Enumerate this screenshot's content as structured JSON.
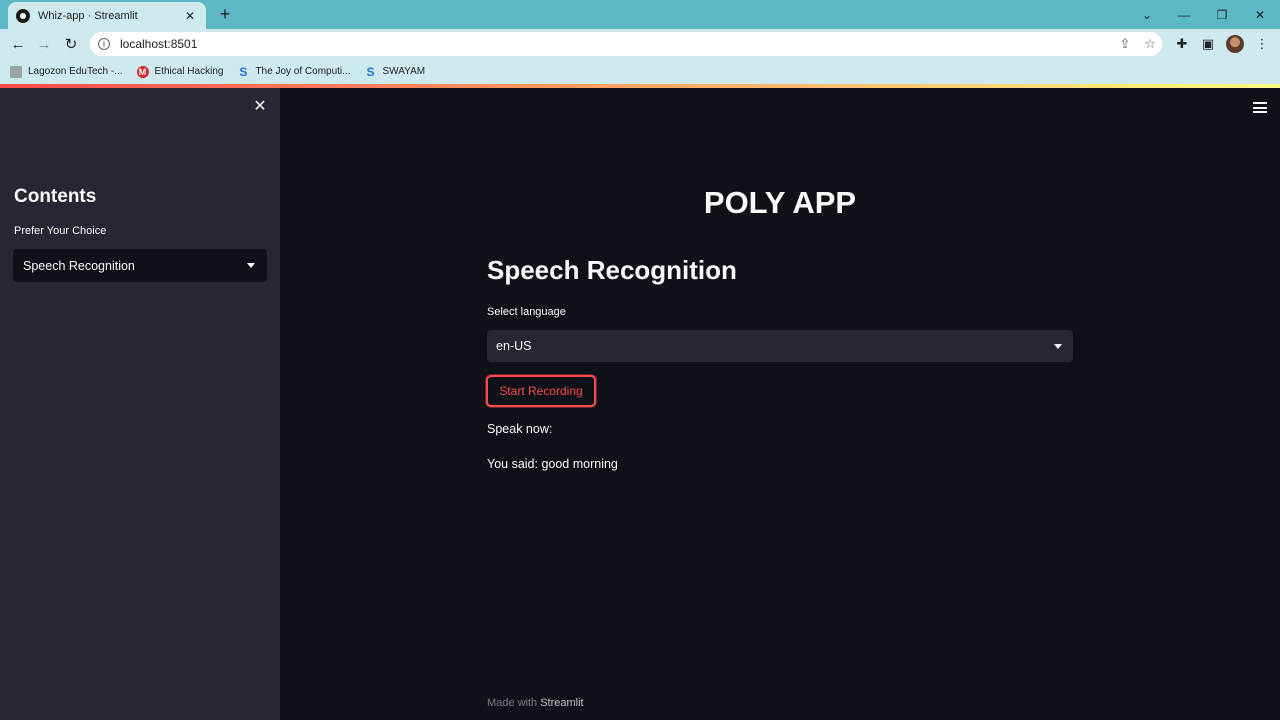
{
  "browser": {
    "tab_title": "Whiz-app · Streamlit",
    "url": "localhost:8501",
    "bookmarks": [
      {
        "label": "Lagozon EduTech -...",
        "icon": "lagozon-icon"
      },
      {
        "label": "Ethical Hacking",
        "icon": "ethical-hacking-icon"
      },
      {
        "label": "The Joy of Computi...",
        "icon": "swayam-icon"
      },
      {
        "label": "SWAYAM",
        "icon": "swayam-icon"
      }
    ]
  },
  "sidebar": {
    "title": "Contents",
    "select_label": "Prefer Your Choice",
    "select_value": "Speech Recognition"
  },
  "main": {
    "app_title": "POLY APP",
    "section_title": "Speech Recognition",
    "language_label": "Select language",
    "language_value": "en-US",
    "record_button": "Start Recording",
    "speak_prompt": "Speak now:",
    "result_text": "You said: good morning",
    "footer_prefix": "Made with",
    "footer_brand": "Streamlit"
  },
  "colors": {
    "accent": "#ff4b4b",
    "background": "#0e1117",
    "sidebar": "#262730",
    "browser_frame": "#5bb8c4"
  }
}
